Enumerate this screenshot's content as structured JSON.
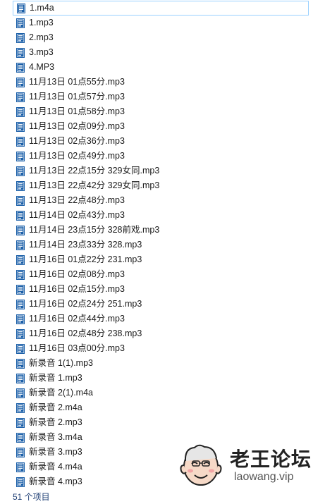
{
  "files": [
    {
      "name": "1.m4a",
      "selected": true
    },
    {
      "name": "1.mp3"
    },
    {
      "name": "2.mp3"
    },
    {
      "name": "3.mp3"
    },
    {
      "name": "4.MP3"
    },
    {
      "name": "11月13日 01点55分.mp3"
    },
    {
      "name": "11月13日 01点57分.mp3"
    },
    {
      "name": "11月13日 01点58分.mp3"
    },
    {
      "name": "11月13日 02点09分.mp3"
    },
    {
      "name": "11月13日 02点36分.mp3"
    },
    {
      "name": "11月13日 02点49分.mp3"
    },
    {
      "name": "11月13日 22点15分 329女同.mp3"
    },
    {
      "name": "11月13日 22点42分 329女同.mp3"
    },
    {
      "name": "11月13日 22点48分.mp3"
    },
    {
      "name": "11月14日 02点43分.mp3"
    },
    {
      "name": "11月14日 23点15分 328前戏.mp3"
    },
    {
      "name": "11月14日 23点33分 328.mp3"
    },
    {
      "name": "11月16日 01点22分 231.mp3"
    },
    {
      "name": "11月16日 02点08分.mp3"
    },
    {
      "name": "11月16日 02点15分.mp3"
    },
    {
      "name": "11月16日 02点24分 251.mp3"
    },
    {
      "name": "11月16日 02点44分.mp3"
    },
    {
      "name": "11月16日 02点48分 238.mp3"
    },
    {
      "name": "11月16日 03点00分.mp3"
    },
    {
      "name": "新录音 1(1).mp3"
    },
    {
      "name": "新录音 1.mp3"
    },
    {
      "name": "新录音 2(1).m4a"
    },
    {
      "name": "新录音 2.m4a"
    },
    {
      "name": "新录音 2.mp3"
    },
    {
      "name": "新录音 3.m4a"
    },
    {
      "name": "新录音 3.mp3"
    },
    {
      "name": "新录音 4.m4a"
    },
    {
      "name": "新录音 4.mp3"
    }
  ],
  "file_icon": "audio-file-icon",
  "status": {
    "item_count": "51 个项目"
  },
  "watermark": {
    "name": "老王论坛",
    "domain": "laowang.vip"
  },
  "colors": {
    "icon_blue": "#1b5fa8",
    "selection_border": "#99d1ff",
    "status_text": "#1e3e74"
  }
}
